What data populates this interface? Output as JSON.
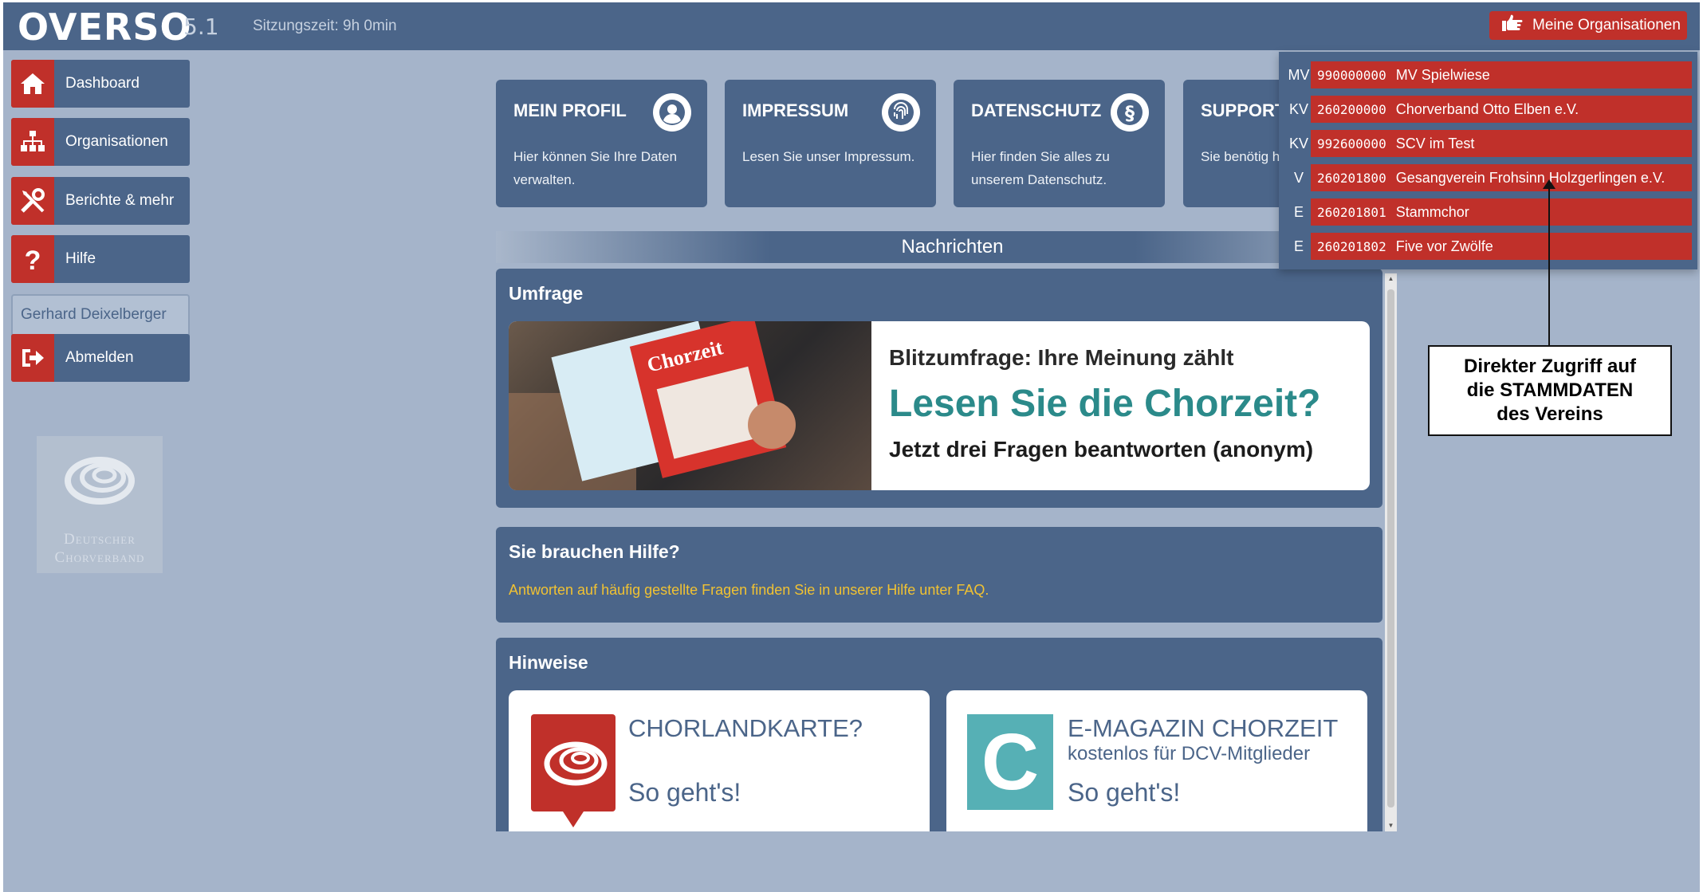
{
  "header": {
    "logo": "OVERSO",
    "version": "5.1",
    "session": "Sitzungszeit: 9h 0min",
    "orgs_button": "Meine Organisationen"
  },
  "sidebar": {
    "items": [
      {
        "label": "Dashboard",
        "icon": "home-icon"
      },
      {
        "label": "Organisationen",
        "icon": "sitemap-icon"
      },
      {
        "label": "Berichte & mehr",
        "icon": "tools-icon"
      },
      {
        "label": "Hilfe",
        "icon": "question-icon"
      }
    ],
    "user": "Gerhard Deixelberger",
    "logout": "Abmelden",
    "logo_text_1": "Deutscher",
    "logo_text_2": "Chorverband"
  },
  "tiles": [
    {
      "title": "MEIN PROFIL",
      "text": "Hier können Sie Ihre Daten verwalten.",
      "icon": "user-icon"
    },
    {
      "title": "IMPRESSUM",
      "text": "Lesen Sie unser Impressum.",
      "icon": "fingerprint-icon"
    },
    {
      "title": "DATENSCHUTZ",
      "text": "Hier finden Sie alles zu unserem Datenschutz.",
      "icon": "paragraph-icon"
    },
    {
      "title": "SUPPORT",
      "text": "Sie benötig haben Fehl"
    }
  ],
  "messages": {
    "header": "Nachrichten",
    "umfrage": {
      "title": "Umfrage",
      "banner_line1": "Blitzumfrage: Ihre Meinung zählt",
      "banner_line2": "Lesen Sie die Chorzeit?",
      "banner_line3": "Jetzt drei Fragen beantworten (anonym)",
      "magazine_label": "Chorzeit"
    },
    "hilfe": {
      "title": "Sie brauchen Hilfe?",
      "text": "Antworten auf häufig gestellte Fragen finden Sie in unserer Hilfe unter FAQ."
    },
    "hinweise": {
      "title": "Hinweise",
      "cards": [
        {
          "title": "CHORLANDKARTE?",
          "subtitle": "",
          "cta": "So geht's!"
        },
        {
          "title": "E-MAGAZIN CHORZEIT",
          "subtitle": "kostenlos für DCV-Mitglieder",
          "cta": "So geht's!",
          "letter": "C"
        }
      ]
    }
  },
  "org_dropdown": {
    "items": [
      {
        "level": "MV",
        "number": "990000000",
        "name": "MV Spielwiese"
      },
      {
        "level": "KV",
        "number": "260200000",
        "name": "Chorverband Otto Elben e.V."
      },
      {
        "level": "KV",
        "number": "992600000",
        "name": "SCV im Test"
      },
      {
        "level": "V",
        "number": "260201800",
        "name": "Gesangverein Frohsinn Holzgerlingen e.V."
      },
      {
        "level": "E",
        "number": "260201801",
        "name": "Stammchor"
      },
      {
        "level": "E",
        "number": "260201802",
        "name": "Five vor Zwölfe"
      }
    ]
  },
  "callout": {
    "line1": "Direkter Zugriff auf",
    "line2": "die STAMMDATEN",
    "line3": "des Vereins"
  },
  "colors": {
    "primary": "#4b6589",
    "accent": "#c0302a",
    "background": "#a5b4ca",
    "highlight": "#f1c232",
    "teal": "#2b8a8a"
  }
}
